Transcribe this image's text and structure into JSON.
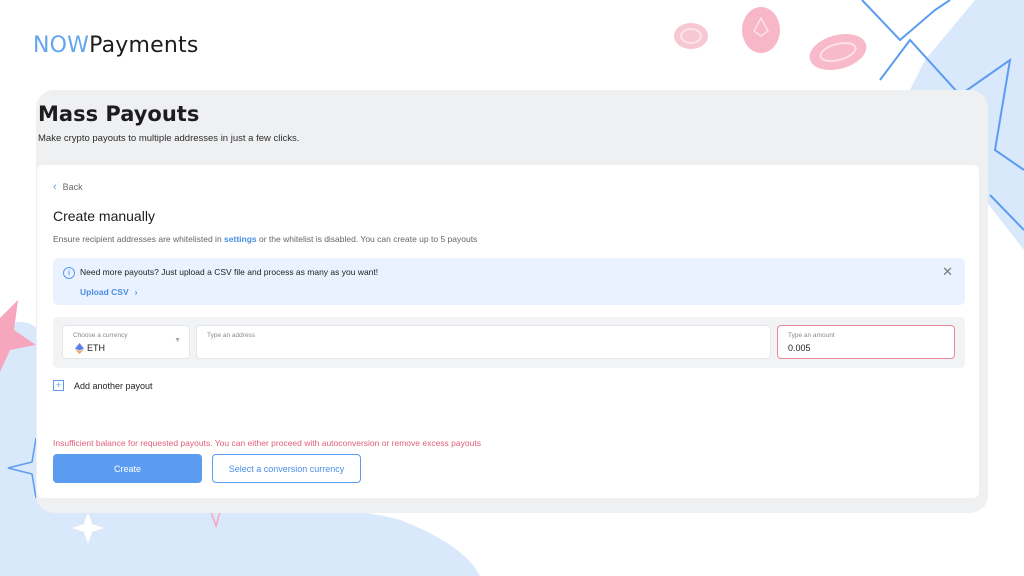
{
  "brand": {
    "part1": "NOW",
    "part2": "Payments"
  },
  "page": {
    "title": "Mass Payouts",
    "subtitle": "Make crypto payouts to multiple addresses in just a few clicks."
  },
  "card": {
    "back_label": "Back",
    "title": "Create manually",
    "note_before": "Ensure recipient addresses are whitelisted in ",
    "note_link": "settings",
    "note_after": " or the whitelist is disabled. You can create up to 5 payouts"
  },
  "info_banner": {
    "icon": "info-icon",
    "text": "Need more payouts? Just upload a CSV file and process as many as you want!",
    "link_label": "Upload CSV",
    "link_chevron": "›",
    "close_glyph": "✕"
  },
  "payout_row": {
    "currency_label": "Choose a currency",
    "currency_value": "ETH",
    "currency_icon": "ethereum-icon",
    "address_placeholder": "Type an address",
    "address_value": "",
    "amount_label": "Type an amount",
    "amount_value": "0.005"
  },
  "add_payout_label": "Add another payout",
  "error_message": "Insufficient balance for requested payouts. You can either proceed with autoconversion or remove excess payouts",
  "buttons": {
    "create": "Create",
    "select_conversion": "Select a conversion currency"
  },
  "colors": {
    "accent": "#5b9cf0",
    "error": "#e35d7d",
    "info_bg": "#eaf2ff",
    "panel_bg": "#eff0f2",
    "deco_pink": "#f7a7bd",
    "deco_blue": "#d9e8fb"
  }
}
